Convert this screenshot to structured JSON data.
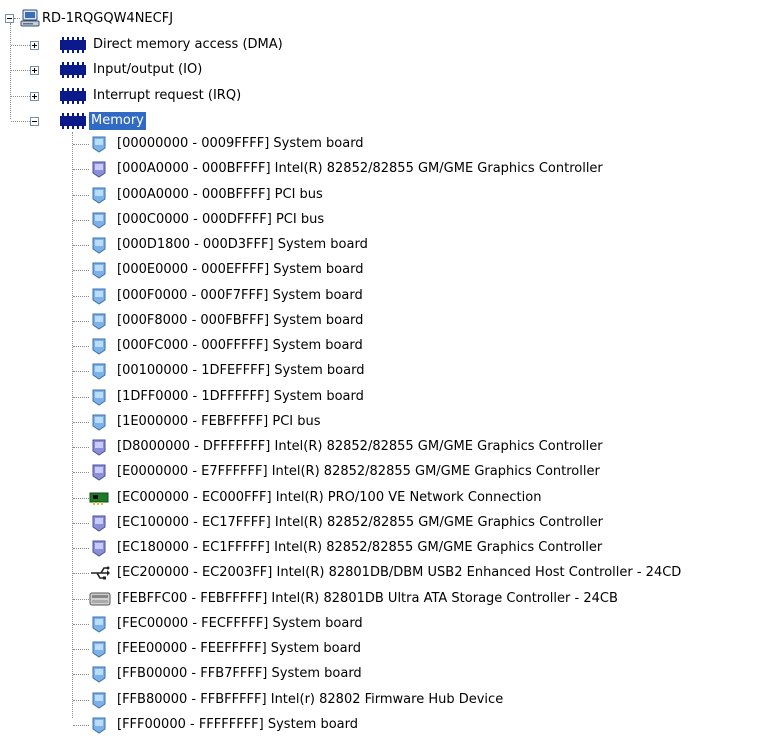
{
  "root": {
    "label": "RD-1RQGQW4NECFJ",
    "icon": "computer-icon"
  },
  "categories": [
    {
      "label": "Direct memory access (DMA)",
      "expanded": false,
      "icon": "resource-chip-icon"
    },
    {
      "label": "Input/output (IO)",
      "expanded": false,
      "icon": "resource-chip-icon"
    },
    {
      "label": "Interrupt request (IRQ)",
      "expanded": false,
      "icon": "resource-chip-icon"
    },
    {
      "label": "Memory",
      "expanded": true,
      "selected": true,
      "icon": "resource-chip-icon"
    }
  ],
  "memory_items": [
    {
      "range": "[00000000 - 0009FFFF]",
      "device": "System board",
      "icon": "system-device-icon"
    },
    {
      "range": "[000A0000 - 000BFFFF]",
      "device": "Intel(R) 82852/82855 GM/GME Graphics Controller",
      "icon": "display-adapter-icon"
    },
    {
      "range": "[000A0000 - 000BFFFF]",
      "device": "PCI bus",
      "icon": "system-device-icon"
    },
    {
      "range": "[000C0000 - 000DFFFF]",
      "device": "PCI bus",
      "icon": "system-device-icon"
    },
    {
      "range": "[000D1800 - 000D3FFF]",
      "device": "System board",
      "icon": "system-device-icon"
    },
    {
      "range": "[000E0000 - 000EFFFF]",
      "device": "System board",
      "icon": "system-device-icon"
    },
    {
      "range": "[000F0000 - 000F7FFF]",
      "device": "System board",
      "icon": "system-device-icon"
    },
    {
      "range": "[000F8000 - 000FBFFF]",
      "device": "System board",
      "icon": "system-device-icon"
    },
    {
      "range": "[000FC000 - 000FFFFF]",
      "device": "System board",
      "icon": "system-device-icon"
    },
    {
      "range": "[00100000 - 1DFEFFFF]",
      "device": "System board",
      "icon": "system-device-icon"
    },
    {
      "range": "[1DFF0000 - 1DFFFFFF]",
      "device": "System board",
      "icon": "system-device-icon"
    },
    {
      "range": "[1E000000 - FEBFFFFF]",
      "device": "PCI bus",
      "icon": "system-device-icon"
    },
    {
      "range": "[D8000000 - DFFFFFFF]",
      "device": "Intel(R) 82852/82855 GM/GME Graphics Controller",
      "icon": "display-adapter-icon"
    },
    {
      "range": "[E0000000 - E7FFFFFF]",
      "device": "Intel(R) 82852/82855 GM/GME Graphics Controller",
      "icon": "display-adapter-icon"
    },
    {
      "range": "[EC000000 - EC000FFF]",
      "device": "Intel(R) PRO/100 VE Network Connection",
      "icon": "network-adapter-icon"
    },
    {
      "range": "[EC100000 - EC17FFFF]",
      "device": "Intel(R) 82852/82855 GM/GME Graphics Controller",
      "icon": "display-adapter-icon"
    },
    {
      "range": "[EC180000 - EC1FFFFF]",
      "device": "Intel(R) 82852/82855 GM/GME Graphics Controller",
      "icon": "display-adapter-icon"
    },
    {
      "range": "[EC200000 - EC2003FF]",
      "device": "Intel(R) 82801DB/DBM USB2 Enhanced Host Controller - 24CD",
      "icon": "usb-icon"
    },
    {
      "range": "[FEBFFC00 - FEBFFFFF]",
      "device": "Intel(R) 82801DB Ultra ATA Storage Controller - 24CB",
      "icon": "storage-controller-icon"
    },
    {
      "range": "[FEC00000 - FECFFFFF]",
      "device": "System board",
      "icon": "system-device-icon"
    },
    {
      "range": "[FEE00000 - FEEFFFFF]",
      "device": "System board",
      "icon": "system-device-icon"
    },
    {
      "range": "[FFB00000 - FFB7FFFF]",
      "device": "System board",
      "icon": "system-device-icon"
    },
    {
      "range": "[FFB80000 - FFBFFFFF]",
      "device": "Intel(r) 82802 Firmware Hub Device",
      "icon": "system-device-icon"
    },
    {
      "range": "[FFF00000 - FFFFFFFF]",
      "device": "System board",
      "icon": "system-device-icon"
    }
  ],
  "colors": {
    "selection": "#316ac5",
    "tree_lines": "#8c8c8c"
  }
}
